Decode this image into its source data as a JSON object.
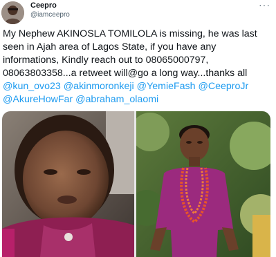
{
  "author": {
    "display_name": "Ceepro",
    "handle": "@iamceepro",
    "avatar_icon": "avatar-photo"
  },
  "more_icon": "more-options-icon",
  "tweet": {
    "text_parts": [
      "My Nephew AKINOSLA TOMILOLA is missing, he was last seen in Ajah area of Lagos State, if you have any informations, Kindly reach out to 08065000797, 08063803358...a retweet will@go a long way...thanks all "
    ],
    "mentions": [
      "@kun_ovo23",
      "@akinmoronkeji",
      "@YemieFash",
      "@CeeproJr",
      "@AkureHowFar",
      "@abraham_olaomi"
    ]
  },
  "media": {
    "count": 2,
    "photos": [
      "child-selfie-photo",
      "child-standing-photo"
    ]
  },
  "colors": {
    "link": "#1d9bf0",
    "text": "#0f1419",
    "secondary": "#536471",
    "shirt": "#9b2a6e"
  }
}
